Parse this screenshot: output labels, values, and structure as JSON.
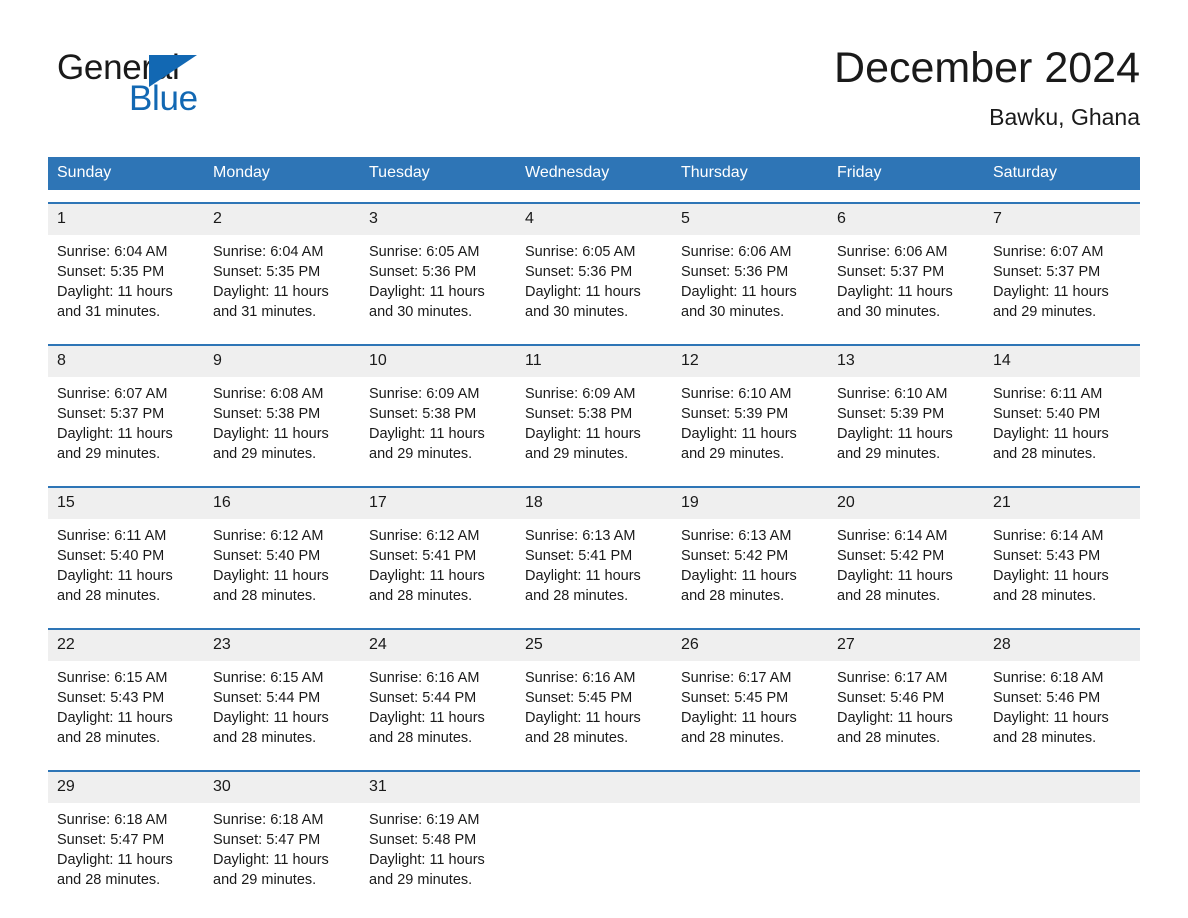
{
  "brand": {
    "name_part1": "General",
    "name_part2": "Blue",
    "accent_color": "#1268b3"
  },
  "header": {
    "title": "December 2024",
    "location": "Bawku, Ghana",
    "header_bg_color": "#2e75b6",
    "date_band_color": "#efefef"
  },
  "weekdays": [
    "Sunday",
    "Monday",
    "Tuesday",
    "Wednesday",
    "Thursday",
    "Friday",
    "Saturday"
  ],
  "weeks": [
    {
      "days": [
        {
          "date": "1",
          "sunrise": "Sunrise: 6:04 AM",
          "sunset": "Sunset: 5:35 PM",
          "daylight": "Daylight: 11 hours and 31 minutes."
        },
        {
          "date": "2",
          "sunrise": "Sunrise: 6:04 AM",
          "sunset": "Sunset: 5:35 PM",
          "daylight": "Daylight: 11 hours and 31 minutes."
        },
        {
          "date": "3",
          "sunrise": "Sunrise: 6:05 AM",
          "sunset": "Sunset: 5:36 PM",
          "daylight": "Daylight: 11 hours and 30 minutes."
        },
        {
          "date": "4",
          "sunrise": "Sunrise: 6:05 AM",
          "sunset": "Sunset: 5:36 PM",
          "daylight": "Daylight: 11 hours and 30 minutes."
        },
        {
          "date": "5",
          "sunrise": "Sunrise: 6:06 AM",
          "sunset": "Sunset: 5:36 PM",
          "daylight": "Daylight: 11 hours and 30 minutes."
        },
        {
          "date": "6",
          "sunrise": "Sunrise: 6:06 AM",
          "sunset": "Sunset: 5:37 PM",
          "daylight": "Daylight: 11 hours and 30 minutes."
        },
        {
          "date": "7",
          "sunrise": "Sunrise: 6:07 AM",
          "sunset": "Sunset: 5:37 PM",
          "daylight": "Daylight: 11 hours and 29 minutes."
        }
      ]
    },
    {
      "days": [
        {
          "date": "8",
          "sunrise": "Sunrise: 6:07 AM",
          "sunset": "Sunset: 5:37 PM",
          "daylight": "Daylight: 11 hours and 29 minutes."
        },
        {
          "date": "9",
          "sunrise": "Sunrise: 6:08 AM",
          "sunset": "Sunset: 5:38 PM",
          "daylight": "Daylight: 11 hours and 29 minutes."
        },
        {
          "date": "10",
          "sunrise": "Sunrise: 6:09 AM",
          "sunset": "Sunset: 5:38 PM",
          "daylight": "Daylight: 11 hours and 29 minutes."
        },
        {
          "date": "11",
          "sunrise": "Sunrise: 6:09 AM",
          "sunset": "Sunset: 5:38 PM",
          "daylight": "Daylight: 11 hours and 29 minutes."
        },
        {
          "date": "12",
          "sunrise": "Sunrise: 6:10 AM",
          "sunset": "Sunset: 5:39 PM",
          "daylight": "Daylight: 11 hours and 29 minutes."
        },
        {
          "date": "13",
          "sunrise": "Sunrise: 6:10 AM",
          "sunset": "Sunset: 5:39 PM",
          "daylight": "Daylight: 11 hours and 29 minutes."
        },
        {
          "date": "14",
          "sunrise": "Sunrise: 6:11 AM",
          "sunset": "Sunset: 5:40 PM",
          "daylight": "Daylight: 11 hours and 28 minutes."
        }
      ]
    },
    {
      "days": [
        {
          "date": "15",
          "sunrise": "Sunrise: 6:11 AM",
          "sunset": "Sunset: 5:40 PM",
          "daylight": "Daylight: 11 hours and 28 minutes."
        },
        {
          "date": "16",
          "sunrise": "Sunrise: 6:12 AM",
          "sunset": "Sunset: 5:40 PM",
          "daylight": "Daylight: 11 hours and 28 minutes."
        },
        {
          "date": "17",
          "sunrise": "Sunrise: 6:12 AM",
          "sunset": "Sunset: 5:41 PM",
          "daylight": "Daylight: 11 hours and 28 minutes."
        },
        {
          "date": "18",
          "sunrise": "Sunrise: 6:13 AM",
          "sunset": "Sunset: 5:41 PM",
          "daylight": "Daylight: 11 hours and 28 minutes."
        },
        {
          "date": "19",
          "sunrise": "Sunrise: 6:13 AM",
          "sunset": "Sunset: 5:42 PM",
          "daylight": "Daylight: 11 hours and 28 minutes."
        },
        {
          "date": "20",
          "sunrise": "Sunrise: 6:14 AM",
          "sunset": "Sunset: 5:42 PM",
          "daylight": "Daylight: 11 hours and 28 minutes."
        },
        {
          "date": "21",
          "sunrise": "Sunrise: 6:14 AM",
          "sunset": "Sunset: 5:43 PM",
          "daylight": "Daylight: 11 hours and 28 minutes."
        }
      ]
    },
    {
      "days": [
        {
          "date": "22",
          "sunrise": "Sunrise: 6:15 AM",
          "sunset": "Sunset: 5:43 PM",
          "daylight": "Daylight: 11 hours and 28 minutes."
        },
        {
          "date": "23",
          "sunrise": "Sunrise: 6:15 AM",
          "sunset": "Sunset: 5:44 PM",
          "daylight": "Daylight: 11 hours and 28 minutes."
        },
        {
          "date": "24",
          "sunrise": "Sunrise: 6:16 AM",
          "sunset": "Sunset: 5:44 PM",
          "daylight": "Daylight: 11 hours and 28 minutes."
        },
        {
          "date": "25",
          "sunrise": "Sunrise: 6:16 AM",
          "sunset": "Sunset: 5:45 PM",
          "daylight": "Daylight: 11 hours and 28 minutes."
        },
        {
          "date": "26",
          "sunrise": "Sunrise: 6:17 AM",
          "sunset": "Sunset: 5:45 PM",
          "daylight": "Daylight: 11 hours and 28 minutes."
        },
        {
          "date": "27",
          "sunrise": "Sunrise: 6:17 AM",
          "sunset": "Sunset: 5:46 PM",
          "daylight": "Daylight: 11 hours and 28 minutes."
        },
        {
          "date": "28",
          "sunrise": "Sunrise: 6:18 AM",
          "sunset": "Sunset: 5:46 PM",
          "daylight": "Daylight: 11 hours and 28 minutes."
        }
      ]
    },
    {
      "days": [
        {
          "date": "29",
          "sunrise": "Sunrise: 6:18 AM",
          "sunset": "Sunset: 5:47 PM",
          "daylight": "Daylight: 11 hours and 28 minutes."
        },
        {
          "date": "30",
          "sunrise": "Sunrise: 6:18 AM",
          "sunset": "Sunset: 5:47 PM",
          "daylight": "Daylight: 11 hours and 29 minutes."
        },
        {
          "date": "31",
          "sunrise": "Sunrise: 6:19 AM",
          "sunset": "Sunset: 5:48 PM",
          "daylight": "Daylight: 11 hours and 29 minutes."
        },
        {
          "date": "",
          "sunrise": "",
          "sunset": "",
          "daylight": ""
        },
        {
          "date": "",
          "sunrise": "",
          "sunset": "",
          "daylight": ""
        },
        {
          "date": "",
          "sunrise": "",
          "sunset": "",
          "daylight": ""
        },
        {
          "date": "",
          "sunrise": "",
          "sunset": "",
          "daylight": ""
        }
      ]
    }
  ]
}
